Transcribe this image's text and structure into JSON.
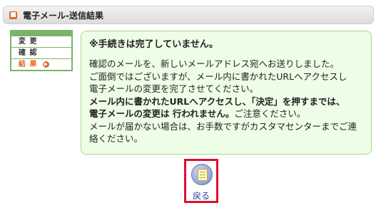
{
  "header": {
    "icon": "orange-square-icon",
    "title": "電子メール-送信結果"
  },
  "steps": {
    "items": [
      {
        "label": "変 更"
      },
      {
        "label": "確 認"
      },
      {
        "label": "結 果"
      }
    ],
    "active_icon": "orange-circle-arrow-icon"
  },
  "message": {
    "heading": "※手続きは完了していません。",
    "lines": [
      "確認のメールを、新しいメールアドレス宛へお送りしました。",
      "ご面倒ではございますが、メール内に書かれたURLへアクセスし",
      "電子メールの変更を完了させてください。",
      "メール内に書かれたURLへアクセスし、「決定」を押すまでは、",
      "電子メールの変更は 行われません。",
      "ご注意ください。",
      "メールが届かない場合は、お手数ですがカスタマセンターまでご連",
      "絡ください。"
    ]
  },
  "back_button": {
    "label": "戻る",
    "icon": "document-icon"
  },
  "colors": {
    "accent": "#e06a1b",
    "frame": "#7ab468",
    "box_bg": "#eefde6",
    "highlight": "#e0102a"
  }
}
